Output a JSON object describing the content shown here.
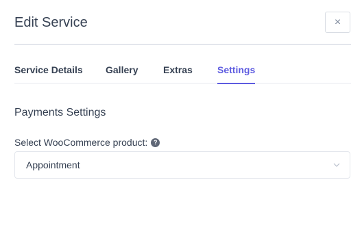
{
  "modal": {
    "title": "Edit Service",
    "close_glyph": "×"
  },
  "tabs": [
    {
      "label": "Service Details",
      "active": false
    },
    {
      "label": "Gallery",
      "active": false
    },
    {
      "label": "Extras",
      "active": false
    },
    {
      "label": "Settings",
      "active": true
    }
  ],
  "settings": {
    "section_title": "Payments Settings",
    "product_label": "Select WooCommerce product:",
    "help_glyph": "?",
    "product_value": "Appointment"
  },
  "icons": {
    "close": "close-icon",
    "help": "question-circle-icon",
    "dropdown": "chevron-down-icon"
  },
  "colors": {
    "accent": "#5d5be0",
    "text": "#354052",
    "border": "#e3e6ec"
  }
}
